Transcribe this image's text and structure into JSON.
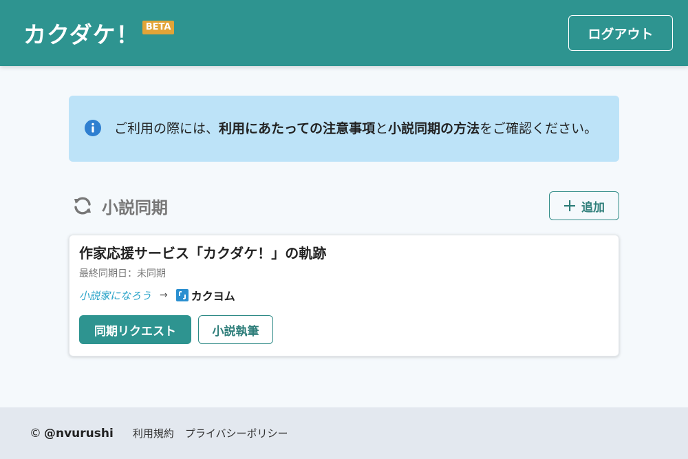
{
  "header": {
    "title": "カクダケ！",
    "badge": "BETA",
    "logout_label": "ログアウト"
  },
  "notice": {
    "icon": "info-icon",
    "text_prefix": "ご利用の際には、",
    "link_terms": "利用にあたっての注意事項",
    "text_and": "と",
    "link_method": "小説同期の方法",
    "text_suffix": "をご確認ください。"
  },
  "section": {
    "icon": "sync-icon",
    "title": "小説同期",
    "add_label": "追加"
  },
  "card": {
    "title": "作家応援サービス「カクダケ！」の軌跡",
    "last_sync": "最終同期日：未同期",
    "source_site": "小説家になろう",
    "arrow": "→",
    "target_site": "カクヨム",
    "sync_request_label": "同期リクエスト",
    "write_novel_label": "小説執筆"
  },
  "footer": {
    "copyright_symbol": "©",
    "copyright": "@nvurushi",
    "terms_label": "利用規約",
    "privacy_label": "プライバシーポリシー"
  },
  "colors": {
    "primary": "#2e9490",
    "badge": "#e2a437",
    "notice_bg": "#bde3f8",
    "info_icon": "#2f7fd0",
    "footer_bg": "#e3e8ef"
  }
}
